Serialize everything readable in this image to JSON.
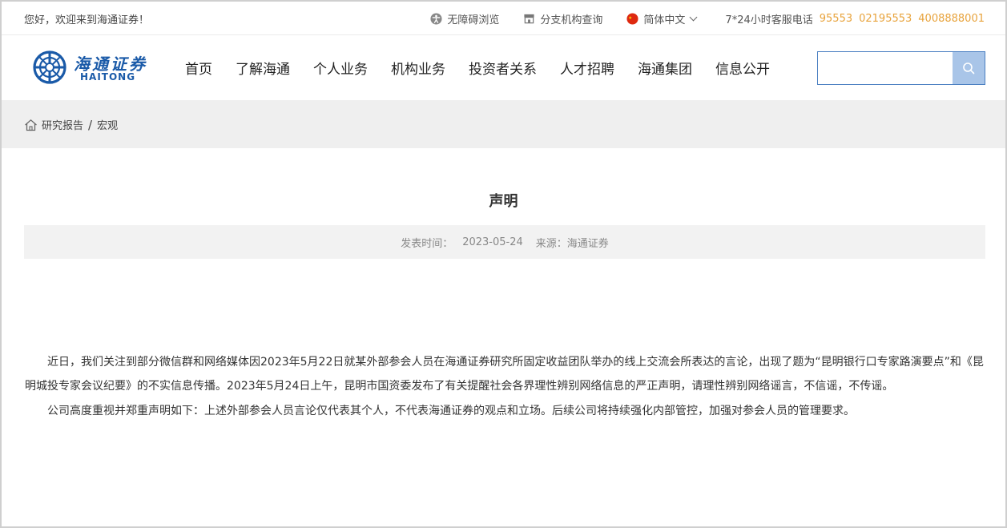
{
  "topbar": {
    "welcome": "您好，欢迎来到海通证券！",
    "accessibility": "无障碍浏览",
    "branch_query": "分支机构查询",
    "language": "简体中文",
    "hotline_label": "7*24小时客服电话",
    "phones": [
      "95553",
      "02195553",
      "4008888001"
    ]
  },
  "logo": {
    "cn": "海通证券",
    "en": "HAITONG",
    "icon": "haitong-logo-icon"
  },
  "nav": {
    "items": [
      "首页",
      "了解海通",
      "个人业务",
      "机构业务",
      "投资者关系",
      "人才招聘",
      "海通集团",
      "信息公开"
    ]
  },
  "search": {
    "placeholder": "",
    "icon": "search-icon"
  },
  "breadcrumb": {
    "icon": "home-icon",
    "items": [
      "研究报告",
      "宏观"
    ],
    "separator": "/"
  },
  "article": {
    "title": "声明",
    "date_label": "发表时间：",
    "date": "2023-05-24",
    "source_label": "来源：",
    "source": "海通证券",
    "paragraphs": [
      "近日，我们关注到部分微信群和网络媒体因2023年5月22日就某外部参会人员在海通证券研究所固定收益团队举办的线上交流会所表达的言论，出现了题为“昆明银行口专家路演要点”和《昆明城投专家会议纪要》的不实信息传播。2023年5月24日上午，昆明市国资委发布了有关提醒社会各界理性辨别网络信息的严正声明，请理性辨别网络谣言，不信谣，不传谣。",
      "公司高度重视并郑重声明如下：上述外部参会人员言论仅代表其个人，不代表海通证券的观点和立场。后续公司将持续强化内部管控，加强对参会人员的管理要求。"
    ]
  },
  "colors": {
    "brand_blue": "#1a5aa8",
    "phone_orange": "#e8a33c",
    "search_button": "#a9c5e8"
  }
}
